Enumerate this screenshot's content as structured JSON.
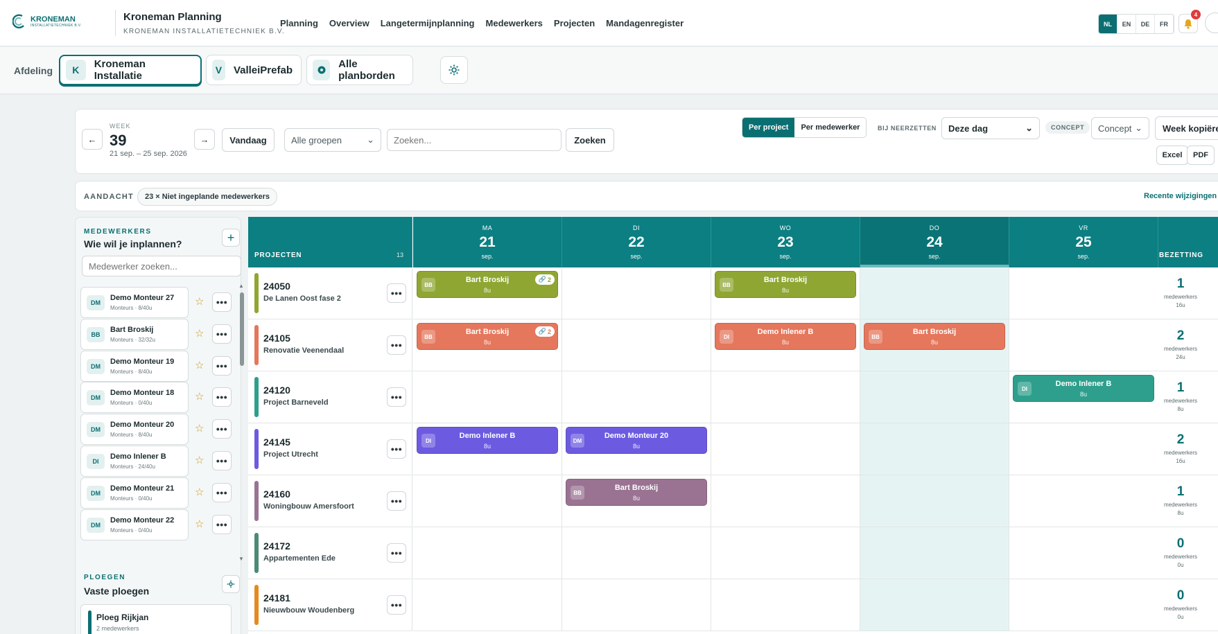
{
  "brand": {
    "logo_name": "KRONEMAN",
    "logo_sub": "INSTALLATIETECHNIEK B.V.",
    "title": "Kroneman Planning",
    "subtitle": "KRONEMAN INSTALLATIETECHNIEK B.V."
  },
  "nav": [
    "Planning",
    "Overview",
    "Langetermijnplanning",
    "Medewerkers",
    "Projecten",
    "Mandagenregister"
  ],
  "languages": {
    "items": [
      "NL",
      "EN",
      "DE",
      "FR"
    ],
    "active": "NL"
  },
  "notifications": {
    "count": "4"
  },
  "department": {
    "label": "Afdeling",
    "items": [
      {
        "letter": "K",
        "name": "Kroneman Installatie",
        "active": true
      },
      {
        "letter": "V",
        "name": "ValleiPrefab",
        "active": false
      },
      {
        "letter": "●",
        "name": "Alle planborden",
        "active": false
      }
    ]
  },
  "toolbar": {
    "week_label": "WEEK",
    "week_number": "39",
    "week_range": "21 sep. – 25 sep. 2026",
    "prev": "←",
    "next": "→",
    "today": "Vandaag",
    "group_select": "Alle groepen",
    "search_placeholder": "Zoeken...",
    "search_button": "Zoeken",
    "view_modes": [
      "Per project",
      "Per medewerker"
    ],
    "view_active": "Per project",
    "drop_label": "BIJ NEERZETTEN",
    "drop_select": "Deze dag",
    "concept_badge": "CONCEPT",
    "concept_select": "Concept",
    "copy_week": "Week kopiëren",
    "excel": "Excel",
    "pdf": "PDF"
  },
  "attention": {
    "label": "AANDACHT",
    "pill": "23 × Niet ingeplande medewerkers",
    "recent": "Recente wijzigingen"
  },
  "employees": {
    "caption": "MEDEWERKERS",
    "title": "Wie wil je inplannen?",
    "search_placeholder": "Medewerker zoeken...",
    "items": [
      {
        "initials": "DM",
        "name": "Demo Monteur 27",
        "meta": "Monteurs · 8/40u"
      },
      {
        "initials": "BB",
        "name": "Bart Broskij",
        "meta": "Monteurs · 32/32u"
      },
      {
        "initials": "DM",
        "name": "Demo Monteur 19",
        "meta": "Monteurs · 8/40u"
      },
      {
        "initials": "DM",
        "name": "Demo Monteur 18",
        "meta": "Monteurs · 0/40u"
      },
      {
        "initials": "DM",
        "name": "Demo Monteur 20",
        "meta": "Monteurs · 8/40u"
      },
      {
        "initials": "DI",
        "name": "Demo Inlener B",
        "meta": "Monteurs · 24/40u"
      },
      {
        "initials": "DM",
        "name": "Demo Monteur 21",
        "meta": "Monteurs · 0/40u"
      },
      {
        "initials": "DM",
        "name": "Demo Monteur 22",
        "meta": "Monteurs · 0/40u"
      }
    ],
    "star": "☆",
    "dots": "•••",
    "crews_caption": "PLOEGEN",
    "crews_title": "Vaste ploegen",
    "crew": {
      "name": "Ploeg Rijkjan",
      "meta": "2 medewerkers",
      "color": "#0b6f72"
    }
  },
  "grid": {
    "projects_header": "PROJECTEN",
    "projects_count": "13",
    "totals_header": "BEZETTING",
    "days": [
      {
        "abbr": "MA",
        "num": "21",
        "month": "sep.",
        "today": false
      },
      {
        "abbr": "DI",
        "num": "22",
        "month": "sep.",
        "today": false
      },
      {
        "abbr": "WO",
        "num": "23",
        "month": "sep.",
        "today": false
      },
      {
        "abbr": "DO",
        "num": "24",
        "month": "sep.",
        "today": true
      },
      {
        "abbr": "VR",
        "num": "25",
        "month": "sep.",
        "today": false
      }
    ],
    "projects": [
      {
        "code": "24050",
        "name": "De Lanen Oost fase 2",
        "color": "#8fa633",
        "total": "1",
        "total_label": "medewerkers",
        "hours": "16u",
        "assignments": [
          {
            "day": 0,
            "initials": "BB",
            "name": "Bart Broskij",
            "hours": "8u",
            "link": "2"
          },
          {
            "day": 2,
            "initials": "BB",
            "name": "Bart Broskij",
            "hours": "8u",
            "link": ""
          }
        ]
      },
      {
        "code": "24105",
        "name": "Renovatie Veenendaal",
        "color": "#e5775c",
        "total": "2",
        "total_label": "medewerkers",
        "hours": "24u",
        "assignments": [
          {
            "day": 0,
            "initials": "BB",
            "name": "Bart Broskij",
            "hours": "8u",
            "link": "2"
          },
          {
            "day": 2,
            "initials": "DI",
            "name": "Demo Inlener B",
            "hours": "8u",
            "link": ""
          },
          {
            "day": 3,
            "initials": "BB",
            "name": "Bart Broskij",
            "hours": "8u",
            "link": ""
          }
        ]
      },
      {
        "code": "24120",
        "name": "Project Barneveld",
        "color": "#2e9f8d",
        "total": "1",
        "total_label": "medewerkers",
        "hours": "8u",
        "assignments": [
          {
            "day": 4,
            "initials": "DI",
            "name": "Demo Inlener B",
            "hours": "8u",
            "link": ""
          }
        ]
      },
      {
        "code": "24145",
        "name": "Project Utrecht",
        "color": "#6c5be0",
        "total": "2",
        "total_label": "medewerkers",
        "hours": "16u",
        "assignments": [
          {
            "day": 0,
            "initials": "DI",
            "name": "Demo Inlener B",
            "hours": "8u",
            "link": ""
          },
          {
            "day": 1,
            "initials": "DM",
            "name": "Demo Monteur 20",
            "hours": "8u",
            "link": ""
          }
        ]
      },
      {
        "code": "24160",
        "name": "Woningbouw Amersfoort",
        "color": "#9a7393",
        "total": "1",
        "total_label": "medewerkers",
        "hours": "8u",
        "assignments": [
          {
            "day": 1,
            "initials": "BB",
            "name": "Bart Broskij",
            "hours": "8u",
            "link": ""
          }
        ]
      },
      {
        "code": "24172",
        "name": "Appartementen Ede",
        "color": "#4c8a76",
        "total": "0",
        "total_label": "medewerkers",
        "hours": "0u",
        "assignments": []
      },
      {
        "code": "24181",
        "name": "Nieuwbouw Woudenberg",
        "color": "#e58a1f",
        "total": "0",
        "total_label": "medewerkers",
        "hours": "0u",
        "assignments": []
      }
    ]
  },
  "colors": {
    "accent": "#0b6f72",
    "header": "#0b7f82",
    "today_column": "#e6f3f3"
  }
}
